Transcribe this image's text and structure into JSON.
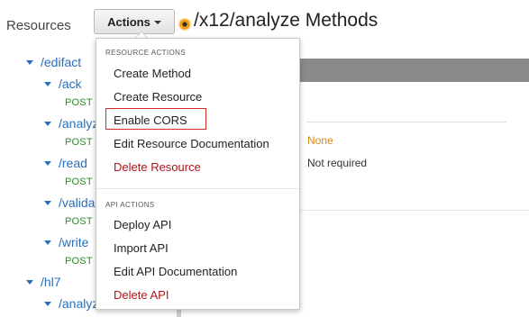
{
  "header": {
    "resources_label": "Resources",
    "actions_label": "Actions",
    "page_title": "/x12/analyze Methods"
  },
  "tree": {
    "edifact": "/edifact",
    "ack": "/ack",
    "ack_method": "POST",
    "analyze": "/analyz",
    "analyze_method": "POST",
    "read": "/read",
    "read_method": "POST",
    "validate": "/valida",
    "validate_method": "POST",
    "write": "/write",
    "write_method": "POST",
    "hl7": "/hl7",
    "hl7_analyze": "/analyz"
  },
  "panel": {
    "colon": ":",
    "none_value": "None",
    "not_required_value": "Not required"
  },
  "menu": {
    "resource_actions_header": "RESOURCE ACTIONS",
    "create_method": "Create Method",
    "create_resource": "Create Resource",
    "enable_cors": "Enable CORS",
    "edit_resource_doc": "Edit Resource Documentation",
    "delete_resource": "Delete Resource",
    "api_actions_header": "API ACTIONS",
    "deploy_api": "Deploy API",
    "import_api": "Import API",
    "edit_api_doc": "Edit API Documentation",
    "delete_api": "Delete API"
  },
  "colors": {
    "link_blue": "#2a6ebb",
    "method_green": "#2b8a2b",
    "danger_red": "#b0141a",
    "highlight_red": "#d42a2a",
    "accent_orange": "#f39c12"
  }
}
